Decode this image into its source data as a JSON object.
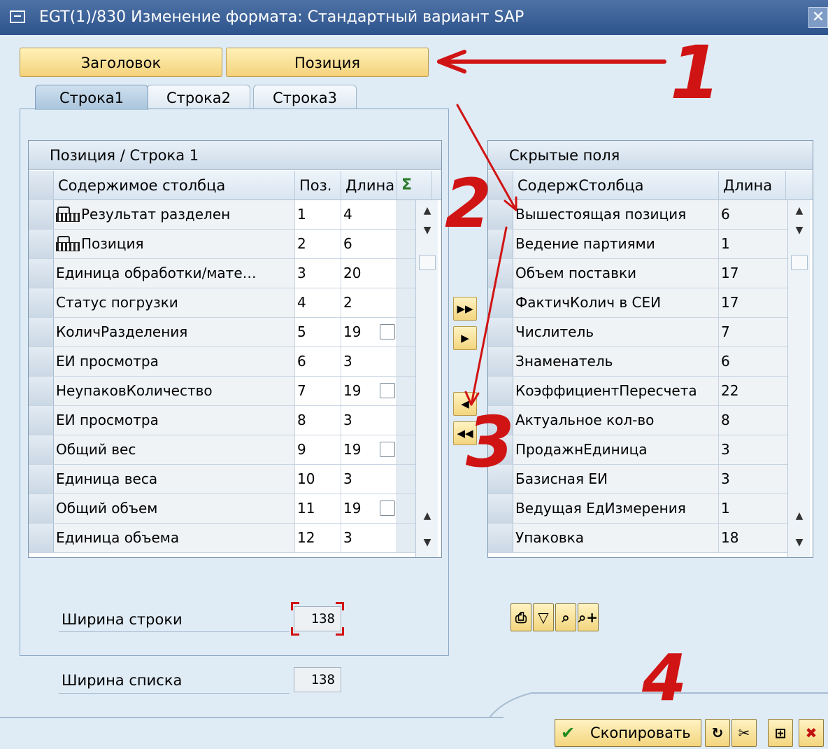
{
  "window": {
    "title": "EGT(1)/830 Изменение формата: Стандартный вариант SAP",
    "close_label": "✕"
  },
  "top_buttons": {
    "header": "Заголовок",
    "item": "Позиция"
  },
  "tabs": [
    {
      "label": "Строка1",
      "active": true
    },
    {
      "label": "Строка2",
      "active": false
    },
    {
      "label": "Строка3",
      "active": false
    }
  ],
  "left_table": {
    "title": "Позиция / Строка 1",
    "columns": {
      "content": "Содержимое столбца",
      "pos": "Поз.",
      "length": "Длина",
      "sum": "Σ"
    },
    "rows": [
      {
        "key": true,
        "content": "Результат разделен",
        "pos": "1",
        "length": "4",
        "checkbox": false
      },
      {
        "key": true,
        "content": "Позиция",
        "pos": "2",
        "length": "6",
        "checkbox": false
      },
      {
        "key": false,
        "content": "Единица обработки/мате…",
        "pos": "3",
        "length": "20",
        "checkbox": false
      },
      {
        "key": false,
        "content": "Статус погрузки",
        "pos": "4",
        "length": "2",
        "checkbox": false
      },
      {
        "key": false,
        "content": "КоличРазделения",
        "pos": "5",
        "length": "19",
        "checkbox": true
      },
      {
        "key": false,
        "content": "ЕИ просмотра",
        "pos": "6",
        "length": "3",
        "checkbox": false
      },
      {
        "key": false,
        "content": "НеупаковКоличество",
        "pos": "7",
        "length": "19",
        "checkbox": true
      },
      {
        "key": false,
        "content": "ЕИ просмотра",
        "pos": "8",
        "length": "3",
        "checkbox": false
      },
      {
        "key": false,
        "content": "Общий вес",
        "pos": "9",
        "length": "19",
        "checkbox": true
      },
      {
        "key": false,
        "content": "Единица веса",
        "pos": "10",
        "length": "3",
        "checkbox": false
      },
      {
        "key": false,
        "content": "Общий объем",
        "pos": "11",
        "length": "19",
        "checkbox": true
      },
      {
        "key": false,
        "content": "Единица объема",
        "pos": "12",
        "length": "3",
        "checkbox": false
      }
    ]
  },
  "right_table": {
    "title": "Скрытые поля",
    "columns": {
      "content": "СодержСтолбца",
      "length": "Длина"
    },
    "rows": [
      {
        "content": "Вышестоящая позиция",
        "length": "6"
      },
      {
        "content": "Ведение партиями",
        "length": "1"
      },
      {
        "content": "Объем поставки",
        "length": "17"
      },
      {
        "content": "ФактичКолич в СЕИ",
        "length": "17"
      },
      {
        "content": "Числитель",
        "length": "7"
      },
      {
        "content": "Знаменатель",
        "length": "6"
      },
      {
        "content": "КоэффициентПересчета",
        "length": "22"
      },
      {
        "content": "Актуальное кол-во",
        "length": "8"
      },
      {
        "content": "ПродажнЕдиница",
        "length": "3"
      },
      {
        "content": "Базисная ЕИ",
        "length": "3"
      },
      {
        "content": "Ведущая ЕдИзмерения",
        "length": "1"
      },
      {
        "content": "Упаковка",
        "length": "18"
      }
    ]
  },
  "fields": {
    "row_width_label": "Ширина строки",
    "row_width_value": "138",
    "list_width_label": "Ширина списка",
    "list_width_value": "138"
  },
  "buttons": {
    "copy": "Скопировать"
  },
  "annotations": {
    "n1": "1",
    "n2": "2",
    "n3": "3",
    "n4": "4",
    "color": "#d01414"
  },
  "icons": {
    "move_all_right": "double-right-arrow-icon",
    "move_right": "right-arrow-icon",
    "move_left": "left-arrow-icon",
    "move_all_left": "double-left-arrow-icon",
    "tools": [
      "print-icon",
      "filter-icon",
      "find-icon",
      "find-next-icon"
    ],
    "footer": [
      "refresh-icon",
      "cut-icon",
      "layout-icon",
      "cancel-icon"
    ]
  }
}
